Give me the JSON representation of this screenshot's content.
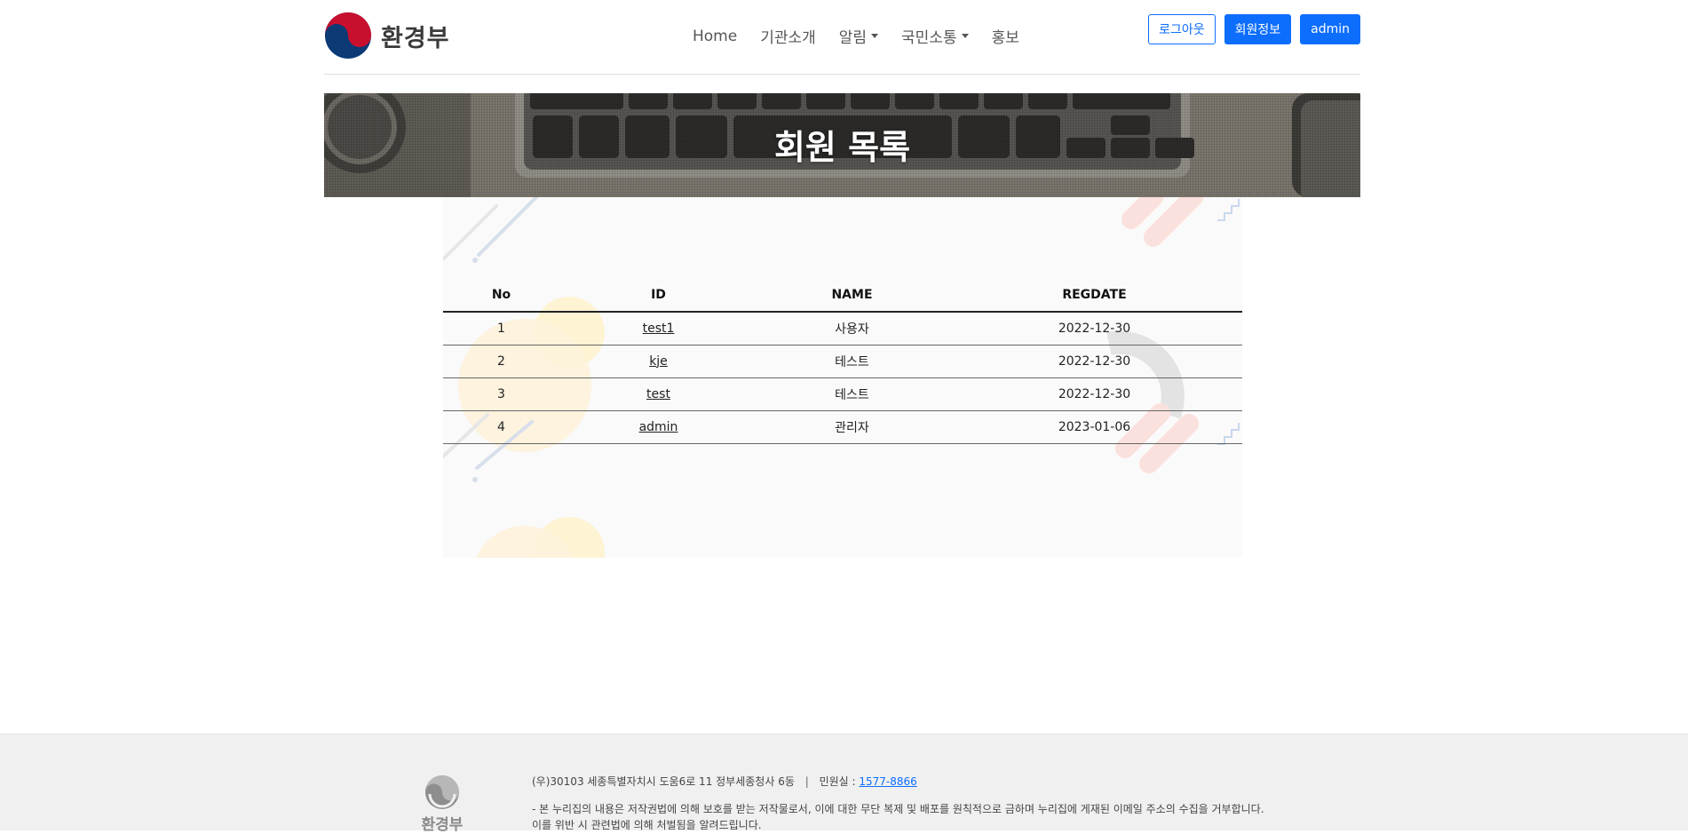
{
  "header": {
    "logo_text": "환경부",
    "nav": [
      {
        "label": "Home"
      },
      {
        "label": "기관소개"
      },
      {
        "label": "알림"
      },
      {
        "label": "국민소통"
      },
      {
        "label": "홍보"
      }
    ],
    "buttons": {
      "logout": "로그아웃",
      "member_info": "회원정보",
      "admin": "admin"
    }
  },
  "banner": {
    "title": "회원 목록"
  },
  "table": {
    "columns": [
      "No",
      "ID",
      "NAME",
      "REGDATE"
    ],
    "rows": [
      {
        "no": "1",
        "id": "test1",
        "name": "사용자",
        "regdate": "2022-12-30"
      },
      {
        "no": "2",
        "id": "kje",
        "name": "테스트",
        "regdate": "2022-12-30"
      },
      {
        "no": "3",
        "id": "test",
        "name": "테스트",
        "regdate": "2022-12-30"
      },
      {
        "no": "4",
        "id": "admin",
        "name": "관리자",
        "regdate": "2023-01-06"
      }
    ]
  },
  "footer": {
    "logo_text": "환경부",
    "address": "(우)30103 세종특별자치시 도움6로 11 정부세종청사 6동",
    "separator": "|",
    "call_label": "민원실 :",
    "call_number": "1577-8866",
    "notice_line1": "- 본 누리집의 내용은 저작권법에 의해 보호를 받는 저작물로서, 이에 대한 무단 복제 및 배포를 원칙적으로 금하며 누리집에 게재된 이메일 주소의 수집을 거부합니다.",
    "notice_line2": "이를 위반 시 관련법에 의해 처벌됨을 알려드립니다."
  },
  "colors": {
    "primary": "#0d6efd",
    "emblem_red": "#c8102e",
    "emblem_blue": "#0b3a75"
  }
}
